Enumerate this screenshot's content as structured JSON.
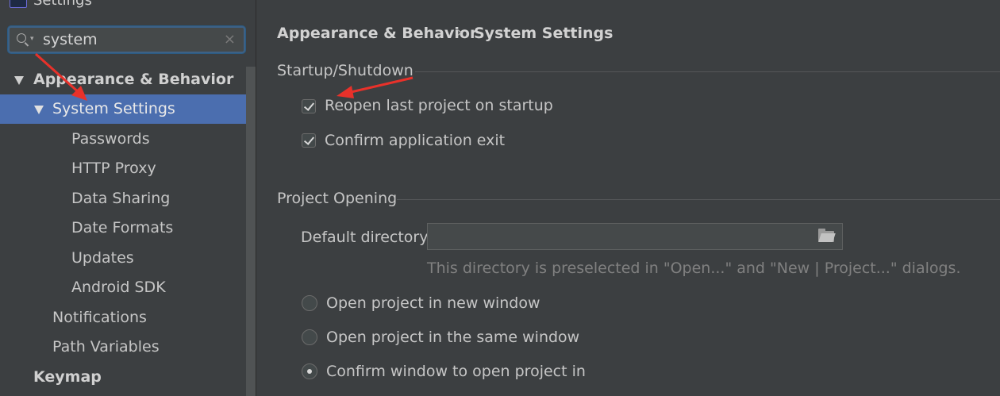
{
  "window": {
    "title": "Settings"
  },
  "search": {
    "value": "system",
    "clear_icon": "×"
  },
  "tree": {
    "appearance": "Appearance & Behavior",
    "system_settings": "System Settings",
    "passwords": "Passwords",
    "http_proxy": "HTTP Proxy",
    "data_sharing": "Data Sharing",
    "date_formats": "Date Formats",
    "updates": "Updates",
    "android_sdk": "Android SDK",
    "notifications": "Notifications",
    "path_variables": "Path Variables",
    "keymap": "Keymap"
  },
  "breadcrumb": {
    "parent": "Appearance & Behavior",
    "separator": "›",
    "current": "System Settings"
  },
  "startup": {
    "title": "Startup/Shutdown",
    "reopen_label": "Reopen last project on startup",
    "reopen_checked": true,
    "confirm_exit_label": "Confirm application exit",
    "confirm_exit_checked": true
  },
  "project_opening": {
    "title": "Project Opening",
    "default_dir_label": "Default directory:",
    "default_dir_value": "",
    "hint": "This directory is preselected in \"Open...\" and \"New | Project...\" dialogs.",
    "options": [
      {
        "label": "Open project in new window",
        "selected": false
      },
      {
        "label": "Open project in the same window",
        "selected": false
      },
      {
        "label": "Confirm window to open project in",
        "selected": true
      }
    ]
  },
  "colors": {
    "selection": "#4b6eaf",
    "annotation_arrow": "#e8312a",
    "background": "#3c3f41"
  }
}
